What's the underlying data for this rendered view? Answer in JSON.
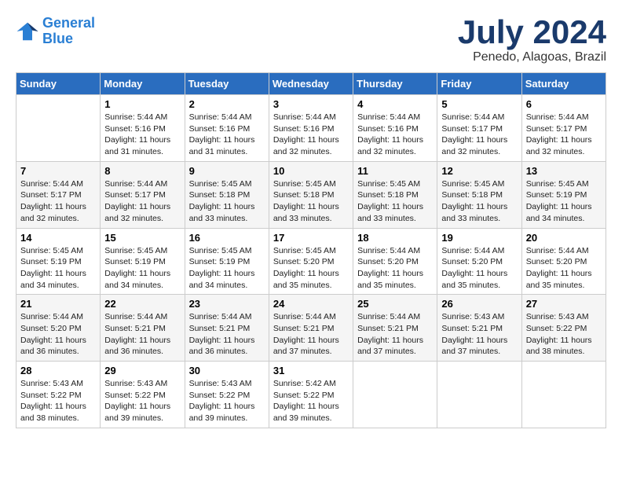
{
  "logo": {
    "line1": "General",
    "line2": "Blue"
  },
  "title": "July 2024",
  "location": "Penedo, Alagoas, Brazil",
  "header_days": [
    "Sunday",
    "Monday",
    "Tuesday",
    "Wednesday",
    "Thursday",
    "Friday",
    "Saturday"
  ],
  "weeks": [
    [
      {
        "day": "",
        "detail": ""
      },
      {
        "day": "1",
        "detail": "Sunrise: 5:44 AM\nSunset: 5:16 PM\nDaylight: 11 hours\nand 31 minutes."
      },
      {
        "day": "2",
        "detail": "Sunrise: 5:44 AM\nSunset: 5:16 PM\nDaylight: 11 hours\nand 31 minutes."
      },
      {
        "day": "3",
        "detail": "Sunrise: 5:44 AM\nSunset: 5:16 PM\nDaylight: 11 hours\nand 32 minutes."
      },
      {
        "day": "4",
        "detail": "Sunrise: 5:44 AM\nSunset: 5:16 PM\nDaylight: 11 hours\nand 32 minutes."
      },
      {
        "day": "5",
        "detail": "Sunrise: 5:44 AM\nSunset: 5:17 PM\nDaylight: 11 hours\nand 32 minutes."
      },
      {
        "day": "6",
        "detail": "Sunrise: 5:44 AM\nSunset: 5:17 PM\nDaylight: 11 hours\nand 32 minutes."
      }
    ],
    [
      {
        "day": "7",
        "detail": "Sunrise: 5:44 AM\nSunset: 5:17 PM\nDaylight: 11 hours\nand 32 minutes."
      },
      {
        "day": "8",
        "detail": "Sunrise: 5:44 AM\nSunset: 5:17 PM\nDaylight: 11 hours\nand 32 minutes."
      },
      {
        "day": "9",
        "detail": "Sunrise: 5:45 AM\nSunset: 5:18 PM\nDaylight: 11 hours\nand 33 minutes."
      },
      {
        "day": "10",
        "detail": "Sunrise: 5:45 AM\nSunset: 5:18 PM\nDaylight: 11 hours\nand 33 minutes."
      },
      {
        "day": "11",
        "detail": "Sunrise: 5:45 AM\nSunset: 5:18 PM\nDaylight: 11 hours\nand 33 minutes."
      },
      {
        "day": "12",
        "detail": "Sunrise: 5:45 AM\nSunset: 5:18 PM\nDaylight: 11 hours\nand 33 minutes."
      },
      {
        "day": "13",
        "detail": "Sunrise: 5:45 AM\nSunset: 5:19 PM\nDaylight: 11 hours\nand 34 minutes."
      }
    ],
    [
      {
        "day": "14",
        "detail": "Sunrise: 5:45 AM\nSunset: 5:19 PM\nDaylight: 11 hours\nand 34 minutes."
      },
      {
        "day": "15",
        "detail": "Sunrise: 5:45 AM\nSunset: 5:19 PM\nDaylight: 11 hours\nand 34 minutes."
      },
      {
        "day": "16",
        "detail": "Sunrise: 5:45 AM\nSunset: 5:19 PM\nDaylight: 11 hours\nand 34 minutes."
      },
      {
        "day": "17",
        "detail": "Sunrise: 5:45 AM\nSunset: 5:20 PM\nDaylight: 11 hours\nand 35 minutes."
      },
      {
        "day": "18",
        "detail": "Sunrise: 5:44 AM\nSunset: 5:20 PM\nDaylight: 11 hours\nand 35 minutes."
      },
      {
        "day": "19",
        "detail": "Sunrise: 5:44 AM\nSunset: 5:20 PM\nDaylight: 11 hours\nand 35 minutes."
      },
      {
        "day": "20",
        "detail": "Sunrise: 5:44 AM\nSunset: 5:20 PM\nDaylight: 11 hours\nand 35 minutes."
      }
    ],
    [
      {
        "day": "21",
        "detail": "Sunrise: 5:44 AM\nSunset: 5:20 PM\nDaylight: 11 hours\nand 36 minutes."
      },
      {
        "day": "22",
        "detail": "Sunrise: 5:44 AM\nSunset: 5:21 PM\nDaylight: 11 hours\nand 36 minutes."
      },
      {
        "day": "23",
        "detail": "Sunrise: 5:44 AM\nSunset: 5:21 PM\nDaylight: 11 hours\nand 36 minutes."
      },
      {
        "day": "24",
        "detail": "Sunrise: 5:44 AM\nSunset: 5:21 PM\nDaylight: 11 hours\nand 37 minutes."
      },
      {
        "day": "25",
        "detail": "Sunrise: 5:44 AM\nSunset: 5:21 PM\nDaylight: 11 hours\nand 37 minutes."
      },
      {
        "day": "26",
        "detail": "Sunrise: 5:43 AM\nSunset: 5:21 PM\nDaylight: 11 hours\nand 37 minutes."
      },
      {
        "day": "27",
        "detail": "Sunrise: 5:43 AM\nSunset: 5:22 PM\nDaylight: 11 hours\nand 38 minutes."
      }
    ],
    [
      {
        "day": "28",
        "detail": "Sunrise: 5:43 AM\nSunset: 5:22 PM\nDaylight: 11 hours\nand 38 minutes."
      },
      {
        "day": "29",
        "detail": "Sunrise: 5:43 AM\nSunset: 5:22 PM\nDaylight: 11 hours\nand 39 minutes."
      },
      {
        "day": "30",
        "detail": "Sunrise: 5:43 AM\nSunset: 5:22 PM\nDaylight: 11 hours\nand 39 minutes."
      },
      {
        "day": "31",
        "detail": "Sunrise: 5:42 AM\nSunset: 5:22 PM\nDaylight: 11 hours\nand 39 minutes."
      },
      {
        "day": "",
        "detail": ""
      },
      {
        "day": "",
        "detail": ""
      },
      {
        "day": "",
        "detail": ""
      }
    ]
  ]
}
